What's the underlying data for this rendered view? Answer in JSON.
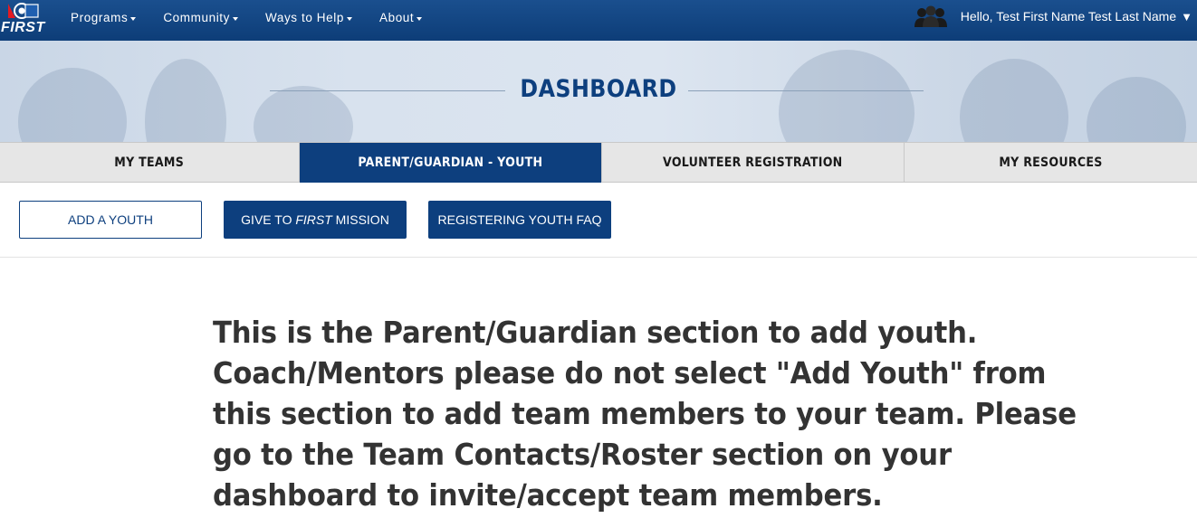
{
  "nav": {
    "logo_text": "FIRST",
    "menu": [
      {
        "label": "Programs"
      },
      {
        "label": "Community"
      },
      {
        "label": "Ways to Help"
      },
      {
        "label": "About"
      }
    ],
    "user_greeting": "Hello, Test First Name Test Last Name",
    "user_dropdown_glyph": "▼"
  },
  "banner": {
    "title": "DASHBOARD"
  },
  "tabs": [
    {
      "label": "MY TEAMS",
      "active": false
    },
    {
      "label": "PARENT/GUARDIAN - YOUTH",
      "active": true
    },
    {
      "label": "VOLUNTEER REGISTRATION",
      "active": false
    },
    {
      "label": "MY RESOURCES",
      "active": false
    }
  ],
  "actions": {
    "add_youth": "ADD A YOUTH",
    "give_prefix": "GIVE TO ",
    "give_emphasis": "FIRST",
    "give_suffix": " MISSION",
    "faq": "REGISTERING YOUTH FAQ"
  },
  "message": {
    "lines": [
      "This is the Parent/Guardian section to add youth.",
      "Coach/Mentors please do not select \"Add Youth\" from",
      "this section to add team members to your team. Please",
      "go to the Team Contacts/Roster section on your",
      "dashboard to invite/accept team members."
    ]
  },
  "colors": {
    "brand_navy": "#0d3f7e",
    "nav_blue": "#1a4f8e",
    "tab_bg": "#e6e6e6"
  }
}
